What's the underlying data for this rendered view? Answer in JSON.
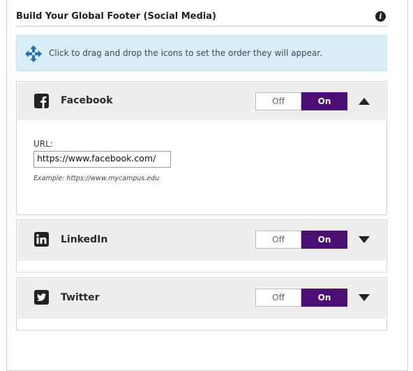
{
  "header": {
    "title": "Build Your Global Footer (Social Media)",
    "info_icon": "info-icon"
  },
  "notice": {
    "icon": "move-arrows-icon",
    "text": "Click to drag and drop the icons to set the order they will appear."
  },
  "colors": {
    "toggle_on": "#4b0f73",
    "notice_bg": "#d9edf7",
    "panel_head_bg": "#eeeeee"
  },
  "panels": [
    {
      "label": "Facebook",
      "icon": "facebook-icon",
      "toggle": {
        "off_label": "Off",
        "on_label": "On",
        "selected": "On"
      },
      "expanded": true,
      "caret": "chevron-up-icon",
      "url_label": "URL:",
      "url_value": "https://www.facebook.com/",
      "example": "Example: https://www.mycampus.edu"
    },
    {
      "label": "LinkedIn",
      "icon": "linkedin-icon",
      "toggle": {
        "off_label": "Off",
        "on_label": "On",
        "selected": "On"
      },
      "expanded": false,
      "caret": "chevron-down-icon"
    },
    {
      "label": "Twitter",
      "icon": "twitter-icon",
      "toggle": {
        "off_label": "Off",
        "on_label": "On",
        "selected": "On"
      },
      "expanded": false,
      "caret": "chevron-down-icon"
    }
  ]
}
